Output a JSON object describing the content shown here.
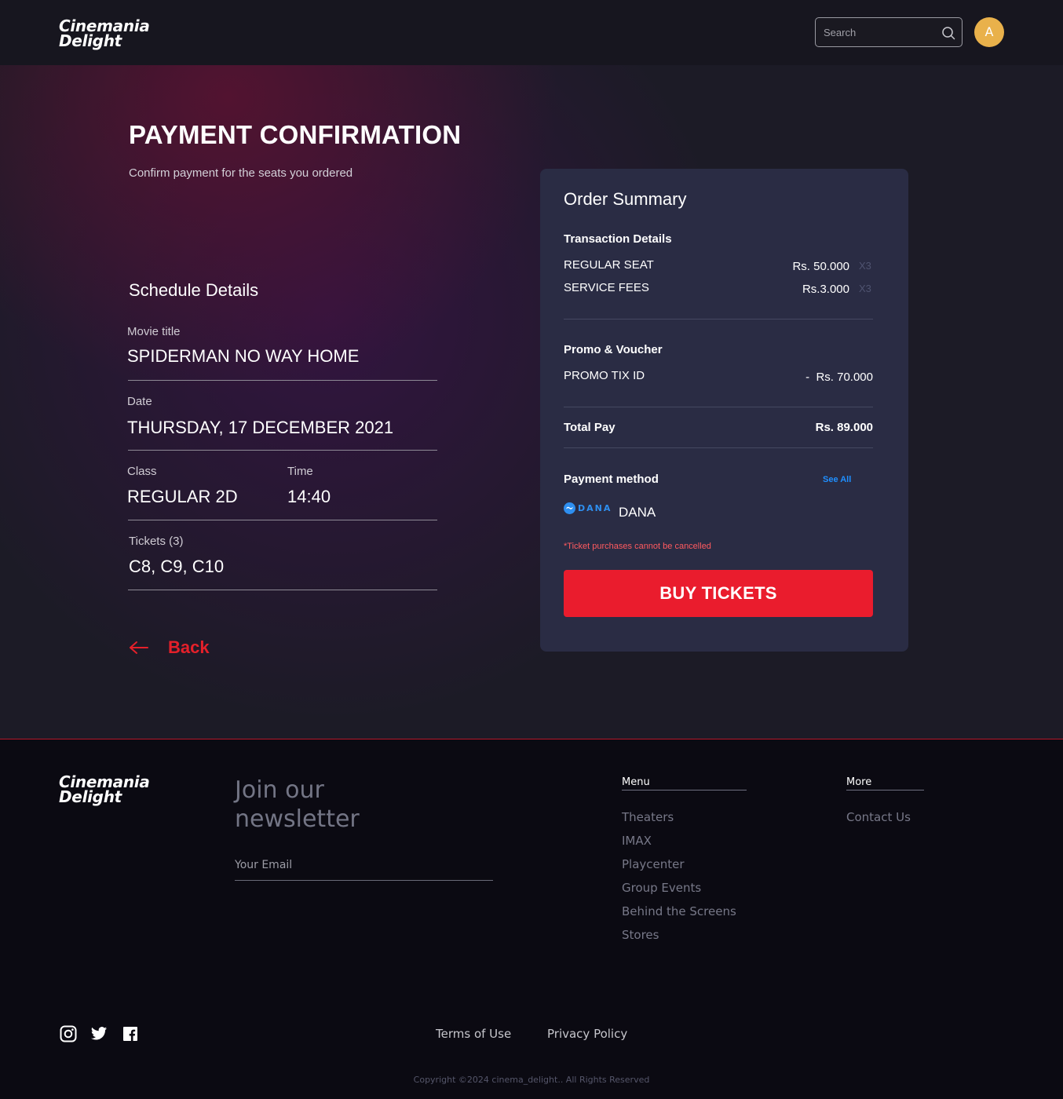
{
  "brand": {
    "line1": "Cinemania",
    "line2": "Delight"
  },
  "header": {
    "search_placeholder": "Search",
    "avatar_initial": "A"
  },
  "page": {
    "title": "PAYMENT CONFIRMATION",
    "subtitle": "Confirm payment for the seats you ordered"
  },
  "schedule": {
    "heading": "Schedule Details",
    "movie_label": "Movie title",
    "movie_value": "SPIDERMAN NO WAY HOME",
    "date_label": "Date",
    "date_value": "THURSDAY, 17 DECEMBER 2021",
    "class_label": "Class",
    "class_value": "REGULAR 2D",
    "time_label": "Time",
    "time_value": "14:40",
    "tickets_label": "Tickets (3)",
    "tickets_value": "C8, C9, C10",
    "back_label": "Back"
  },
  "summary": {
    "title": "Order Summary",
    "transaction_heading": "Transaction Details",
    "items": [
      {
        "label": "REGULAR SEAT",
        "price": "Rs. 50.000",
        "mult": "X3"
      },
      {
        "label": "SERVICE FEES",
        "price": "Rs.3.000",
        "mult": "X3"
      }
    ],
    "promo_heading": "Promo & Voucher",
    "promo_label": "PROMO TIX ID",
    "promo_value": "-  Rs. 70.000",
    "total_label": "Total Pay",
    "total_value": "Rs. 89.000",
    "payment_heading": "Payment method",
    "see_all": "See All",
    "payment_logo_text": "DANA",
    "payment_name": "DANA",
    "warning": "*Ticket purchases cannot be cancelled",
    "buy_label": "BUY TICKETS",
    "accent_color": "#ea1c2d"
  },
  "footer": {
    "newsletter_line1": "Join our",
    "newsletter_line2": "newsletter",
    "email_placeholder": "Your Email",
    "menu_heading": "Menu",
    "menu_items": [
      "Theaters",
      "IMAX",
      "Playcenter",
      "Group Events",
      "Behind the Screens",
      "Stores"
    ],
    "more_heading": "More",
    "more_items": [
      "Contact Us"
    ],
    "social_icons": [
      "instagram-icon",
      "twitter-icon",
      "facebook-icon"
    ],
    "terms": "Terms of Use",
    "privacy": "Privacy Policy",
    "copyright": "Copyright ©2024 cinema_delight.. All Rights Reserved"
  }
}
